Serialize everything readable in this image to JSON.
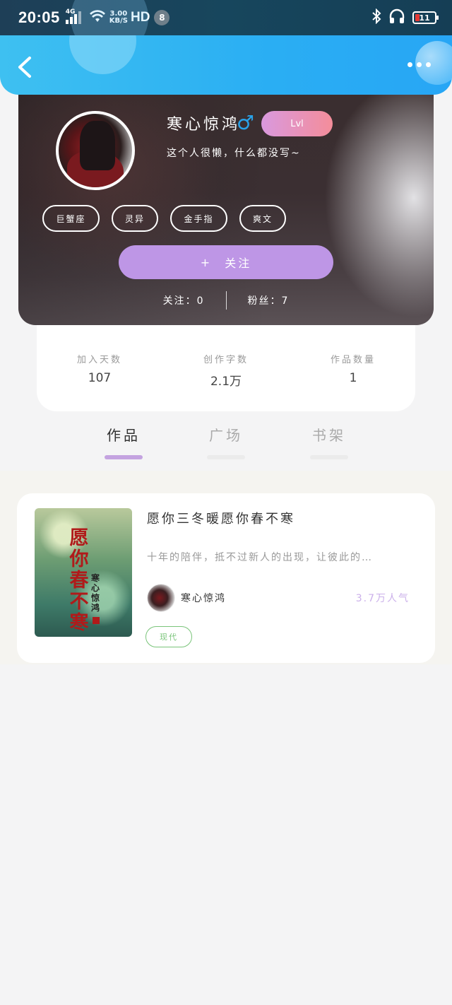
{
  "status_bar": {
    "time": "20:05",
    "network": "4G",
    "speed_value": "3.00",
    "speed_unit": "KB/S",
    "hd": "HD",
    "notification_count": "8",
    "battery": "11"
  },
  "header": {
    "back_icon": "chevron-left-icon",
    "more_icon": "more-dots-icon"
  },
  "profile": {
    "username": "寒心惊鸿",
    "gender_symbol": "♂",
    "level": "Lvl",
    "bio": "这个人很懒，什么都没写~",
    "tags": [
      "巨蟹座",
      "灵异",
      "金手指",
      "爽文"
    ],
    "follow_plus": "+",
    "follow_label": "关注",
    "following": "关注：0",
    "fans": "粉丝：7"
  },
  "stats": [
    {
      "label": "加入天数",
      "value": "107"
    },
    {
      "label": "创作字数",
      "value": "2.1万"
    },
    {
      "label": "作品数量",
      "value": "1"
    }
  ],
  "tabs": [
    {
      "label": "作品",
      "active": true
    },
    {
      "label": "广场",
      "active": false
    },
    {
      "label": "书架",
      "active": false
    }
  ],
  "book": {
    "cover_title": "愿你春不寒",
    "cover_author": "寒心惊鸿",
    "title": "愿你三冬暖愿你春不寒",
    "description": "十年的陪伴，抵不过新人的出现，让彼此的…",
    "author": "寒心惊鸿",
    "popularity": "3.7万人气",
    "genre": "现代"
  },
  "colors": {
    "header_blue": "#2aaef3",
    "accent_purple": "#be96e6",
    "level_gradient_start": "#d999de",
    "level_gradient_end": "#f48d9a",
    "genre_green": "#7ac47a"
  }
}
